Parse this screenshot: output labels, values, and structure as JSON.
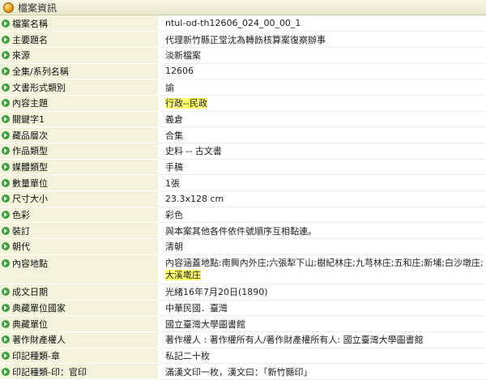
{
  "panel": {
    "title": "檔案資訊"
  },
  "rows": [
    {
      "label": "檔案名稱",
      "value": "ntul-od-th12606_024_00_00_1"
    },
    {
      "label": "主要題名",
      "value": "代理新竹縣正堂沈為轉飭核算案復察辦事"
    },
    {
      "label": "來源",
      "value": "淡新檔案"
    },
    {
      "label": "全集/系列名稱",
      "value": "12606"
    },
    {
      "label": "文書形式類別",
      "value": "諭"
    },
    {
      "label": "內容主題",
      "value": "行政--民政"
    },
    {
      "label": "關鍵字1",
      "value": "義倉"
    },
    {
      "label": "藏品層次",
      "value": "合集"
    },
    {
      "label": "作品類型",
      "value": "史料 -- 古文書"
    },
    {
      "label": "媒體類型",
      "value": "手稿"
    },
    {
      "label": "數量單位",
      "value": "1張"
    },
    {
      "label": "尺寸大小",
      "value": "23.3x128 cm"
    },
    {
      "label": "色彩",
      "value": "彩色"
    },
    {
      "label": "裝訂",
      "value": "與本案其他各件依件號順序互相黏連。"
    },
    {
      "label": "朝代",
      "value": "清朝"
    },
    {
      "label": "內容地點",
      "value_main": "內容涵蓋地點:南興內外庄;六張犁下山;樹紀林庄;九芎林庄;五和庄;新埔;白沙墩庄;",
      "value_hl": "大溪墘庄"
    },
    {
      "label": "成文日期",
      "value": "光緒16年7月20日(1890)"
    },
    {
      "label": "典藏單位國家",
      "value": "中華民國．臺灣"
    },
    {
      "label": "典藏單位",
      "value": "國立臺灣大學圖書館"
    },
    {
      "label": "著作財產權人",
      "value": "著作權人 : 著作權所有人/著作財產權所有人: 國立臺灣大學圖書館"
    },
    {
      "label": "印記種類-章",
      "value": "私記二十枚"
    },
    {
      "label": "印記種類-印：官印",
      "value": "滿漢文印一枚，漢文曰：「新竹縣印」"
    }
  ],
  "colors": {
    "label_bg": "#f4f4dc",
    "highlight": "#ffff66",
    "icon": "#3f9f3f"
  },
  "icons": {
    "header": "orb-icon",
    "row": "arrow-bullet-icon"
  }
}
